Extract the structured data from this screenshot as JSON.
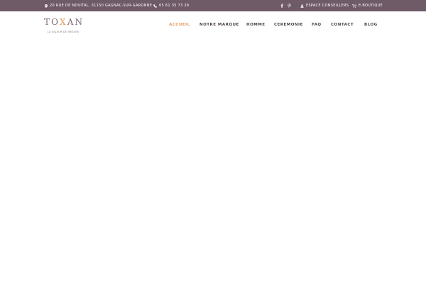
{
  "colors": {
    "topbar_bg": "#6f5a68",
    "accent": "#e29a5a",
    "nav_text": "#4a3f47",
    "background": "#ffffff"
  },
  "topbar": {
    "address": "20 RUE DE NOVITAL, 31150 GAGNAC-SUR-GARONNE",
    "address_icon": "map-pin-icon",
    "phone": "05 61 35 73 28",
    "phone_icon": "phone-icon",
    "social": [
      {
        "name": "facebook-icon"
      },
      {
        "name": "pinterest-icon"
      }
    ],
    "espace_conseillers": "ESPACE CONSEILLERS",
    "espace_icon": "user-icon",
    "eboutique": "E-BOUTIQUE",
    "eboutique_icon": "cart-icon"
  },
  "logo": {
    "letters": [
      "T",
      "O",
      "X",
      "A",
      "N"
    ],
    "tagline": "LA VALEUR DE MESURE"
  },
  "nav": {
    "items": [
      {
        "label": "ACCUEIL",
        "active": true
      },
      {
        "label": "NOTRE MARQUE",
        "active": false
      },
      {
        "label": "HOMME",
        "active": false
      },
      {
        "label": "CEREMONIE",
        "active": false
      },
      {
        "label": "FAQ",
        "active": false
      },
      {
        "label": "CONTACT",
        "active": false
      },
      {
        "label": "BLOG",
        "active": false
      }
    ]
  }
}
